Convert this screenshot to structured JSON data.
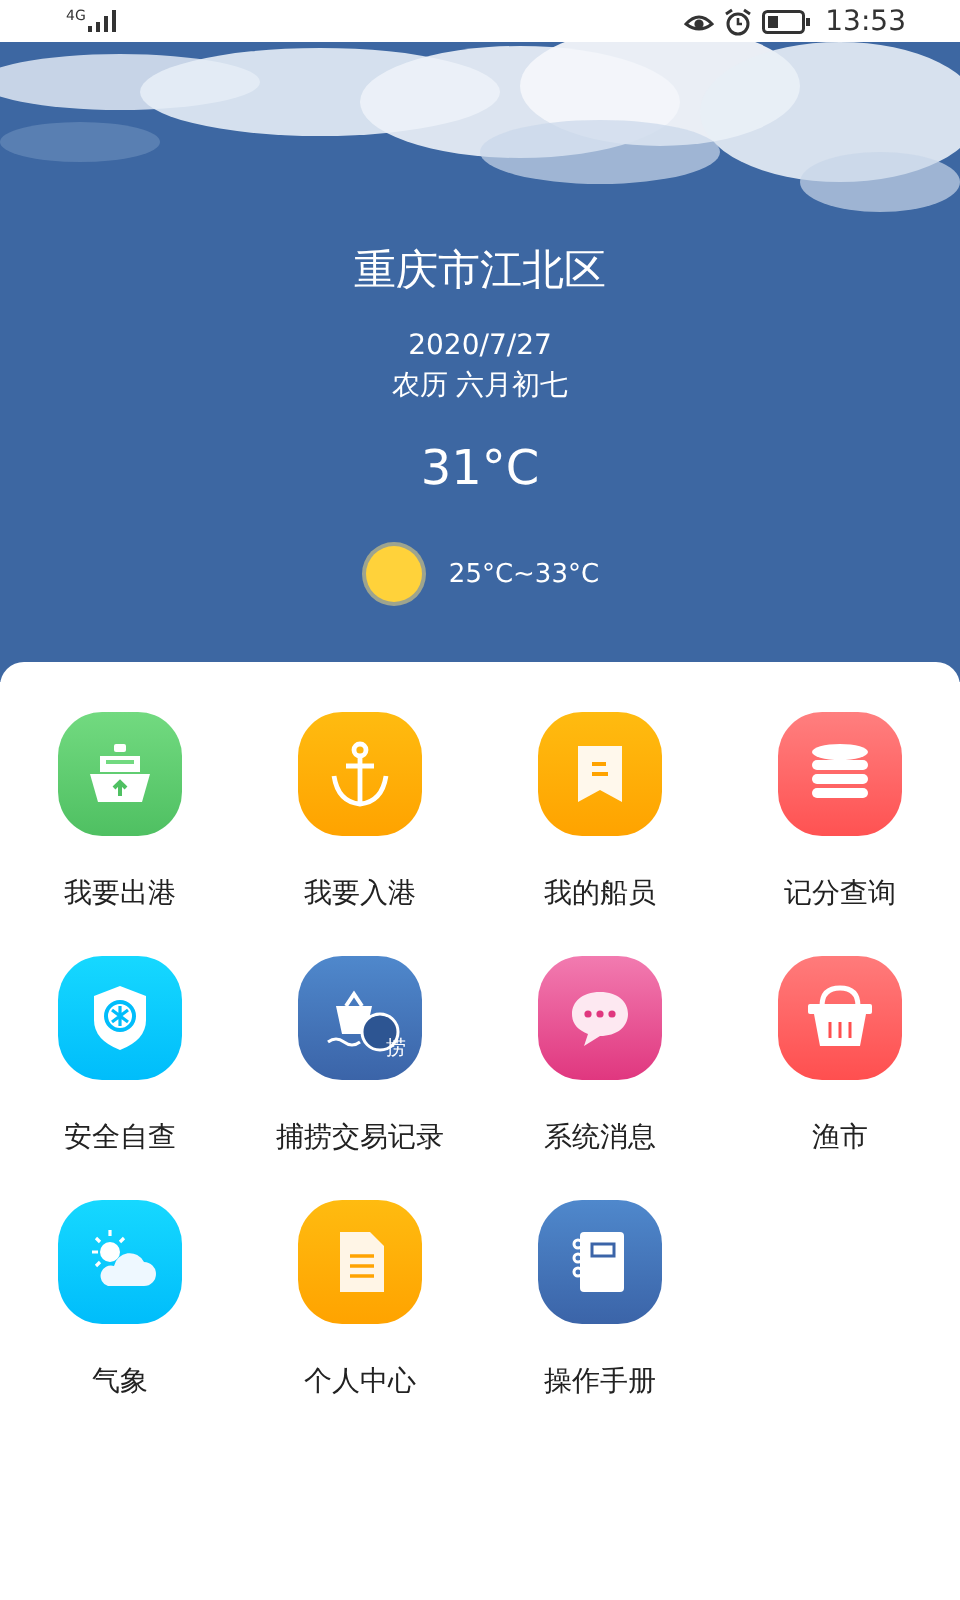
{
  "status_bar": {
    "network": "4G",
    "time": "13:53"
  },
  "weather": {
    "city": "重庆市江北区",
    "date": "2020/7/27",
    "lunar_date": "农历 六月初七",
    "temperature": "31°C",
    "range": "25°C~33°C"
  },
  "menu": [
    {
      "label": "我要出港",
      "kind": "ship-out"
    },
    {
      "label": "我要入港",
      "kind": "anchor"
    },
    {
      "label": "我的船员",
      "kind": "bookmark"
    },
    {
      "label": "记分查询",
      "kind": "database"
    },
    {
      "label": "安全自查",
      "kind": "shield"
    },
    {
      "label": "捕捞交易记录",
      "kind": "catch",
      "badge": "捞"
    },
    {
      "label": "系统消息",
      "kind": "message"
    },
    {
      "label": "渔市",
      "kind": "basket"
    },
    {
      "label": "气象",
      "kind": "weather"
    },
    {
      "label": "个人中心",
      "kind": "document"
    },
    {
      "label": "操作手册",
      "kind": "notebook"
    }
  ]
}
